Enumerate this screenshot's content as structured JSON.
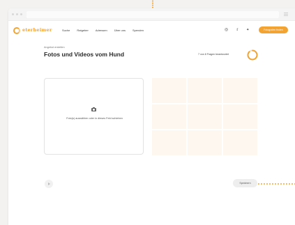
{
  "nav": {
    "logo": "eterheimer",
    "links": [
      "Suche",
      "Ratgeber",
      "Adressen",
      "Über uns",
      "Spenden"
    ],
    "cta_label": "Fotografen finden"
  },
  "breadcrumb": "Angebot erstellen",
  "page_title": "Fotos und Videos vom Hund",
  "progress": {
    "text": "7 von 8 Fragen beantwortet",
    "fraction": 0.875
  },
  "upload": {
    "prompt": "Foto(s) auswählen oder in dieses Feld schieben"
  },
  "grid": {
    "cells": 9
  },
  "footer": {
    "save_label": "Speichern"
  },
  "colors": {
    "accent": "#f2a331",
    "grid_cell": "#fdf7ef"
  },
  "icons": [
    "logo-icon",
    "instagram-icon",
    "facebook-icon",
    "twitter-icon",
    "camera-icon",
    "arrow-right-icon",
    "menu-icon"
  ]
}
